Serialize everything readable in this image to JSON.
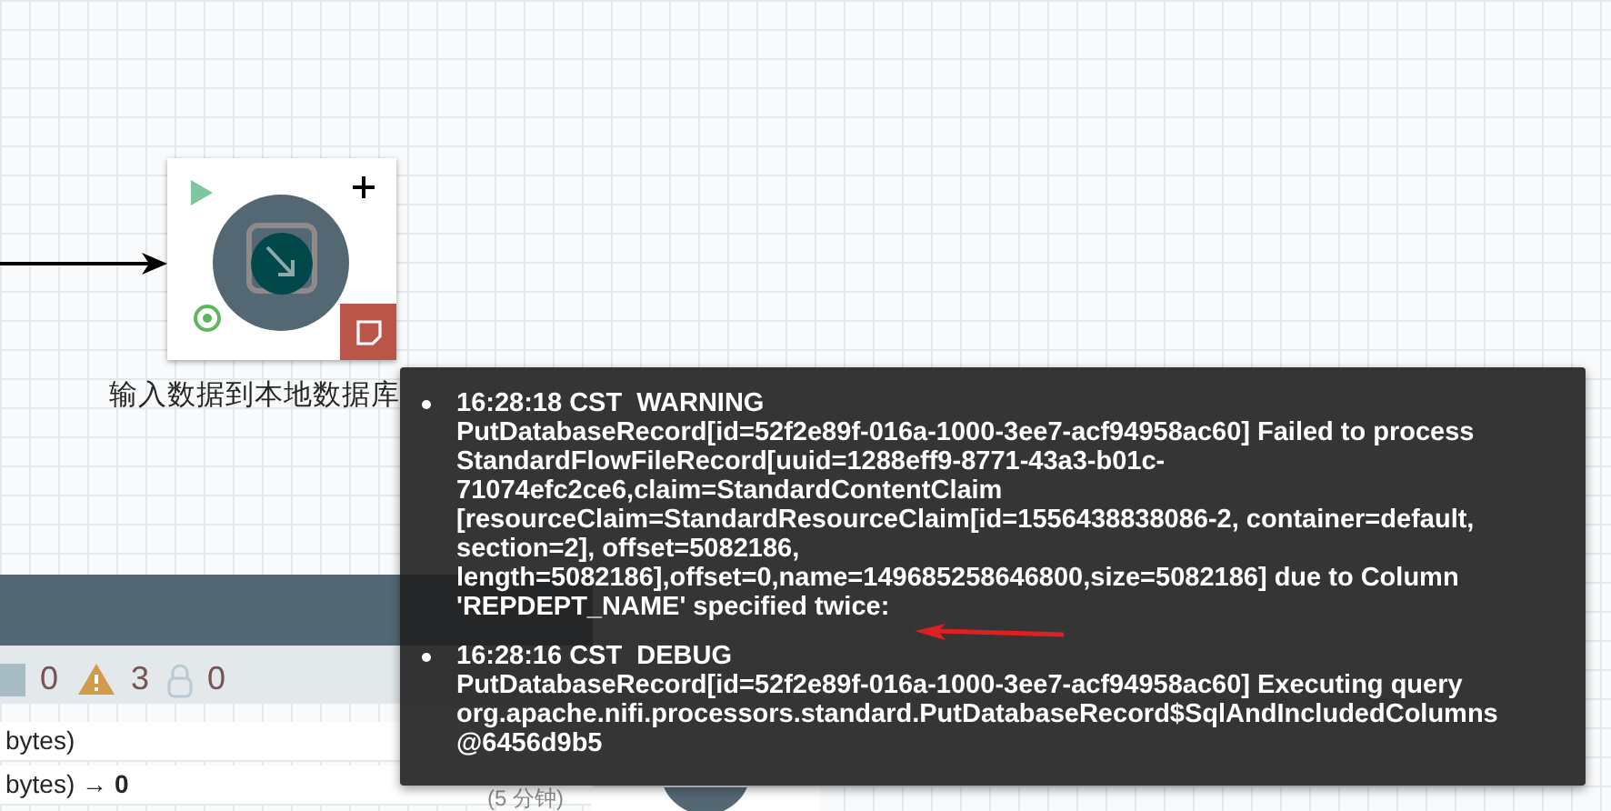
{
  "processor": {
    "name": "输入数据到本地数据库"
  },
  "status_panel": {
    "stats": [
      {
        "kind": "stopped",
        "count": "0"
      },
      {
        "kind": "warning",
        "count": "3"
      },
      {
        "kind": "locked",
        "count": "0"
      }
    ],
    "rows": [
      {
        "text": "bytes)"
      },
      {
        "text": "bytes) →",
        "value": "0"
      }
    ],
    "duration": "(5 分钟)"
  },
  "bulletins": [
    {
      "time": "16:28:18 CST",
      "level": "WARNING",
      "message": "PutDatabaseRecord[id=52f2e89f-016a-1000-3ee7-acf94958ac60] Failed to process StandardFlowFileRecord[uuid=1288eff9-8771-43a3-b01c-71074efc2ce6,claim=StandardContentClaim [resourceClaim=StandardResourceClaim[id=1556438838086-2, container=default, section=2], offset=5082186, length=5082186],offset=0,name=149685258646800,size=5082186] due to Column 'REPDEPT_NAME' specified twice:"
    },
    {
      "time": "16:28:16 CST",
      "level": "DEBUG",
      "message": "PutDatabaseRecord[id=52f2e89f-016a-1000-3ee7-acf94958ac60] Executing query org.apache.nifi.processors.standard.PutDatabaseRecord$SqlAndIncludedColumns @6456d9b5"
    }
  ]
}
